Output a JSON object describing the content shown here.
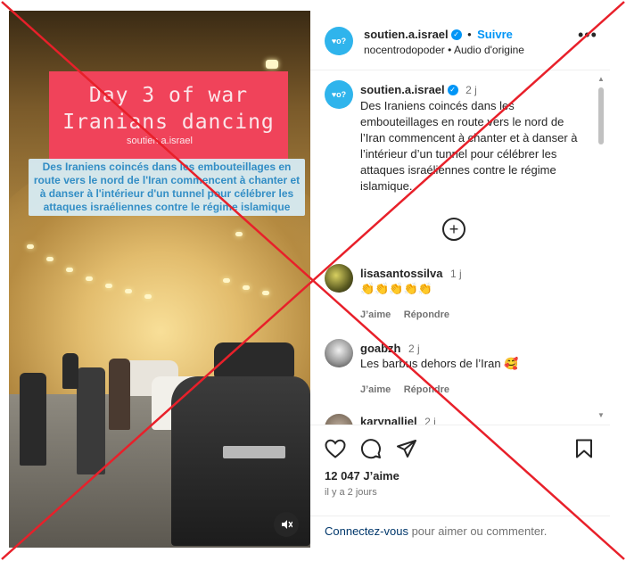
{
  "banner": {
    "line1": "Day 3 of war",
    "line2": "Iranians dancing",
    "handle": "soutien.a.israel"
  },
  "video_caption": "Des Iraniens coincés dans les embouteillages en route vers le nord de l'Iran commencent à chanter et à danser à l'intérieur d'un tunnel pour célébrer les attaques israéliennes contre le régime islamique",
  "header": {
    "username": "soutien.a.israel",
    "dot": "•",
    "follow_label": "Suivre",
    "subline": "nocentrodopoder • Audio d'origine",
    "avatar_text": "♥o?"
  },
  "post": {
    "username": "soutien.a.israel",
    "time": "2 j",
    "caption": "Des Iraniens coincés dans les embouteillages en route vers le nord de l’Iran commencent à chanter et à danser à l’intérieur d’un tunnel pour célébrer les attaques israéliennes contre le régime islamique."
  },
  "comments": [
    {
      "username": "lisasantossilva",
      "time": "1 j",
      "text": "👏👏👏👏👏",
      "like_label": "J’aime",
      "reply_label": "Répondre"
    },
    {
      "username": "goabzh",
      "time": "2 j",
      "text": "Les barbus dehors de l’Iran 🥰",
      "like_label": "J’aime",
      "reply_label": "Répondre"
    },
    {
      "username": "karynalliel",
      "time": "2 j"
    }
  ],
  "stats": {
    "likes": "12 047 J’aime",
    "ago": "il y a 2 jours"
  },
  "login": {
    "link": "Connectez-vous",
    "rest": " pour aimer ou commenter."
  },
  "icons": [
    "heart-icon",
    "comment-icon",
    "share-icon",
    "bookmark-icon",
    "mute-icon",
    "verified-icon",
    "more-icon",
    "add-comments-icon"
  ],
  "colors": {
    "accent": "#0095f6",
    "banner": "#f0435a",
    "caption": "#2a8fd0",
    "strike": "#e8202a"
  }
}
